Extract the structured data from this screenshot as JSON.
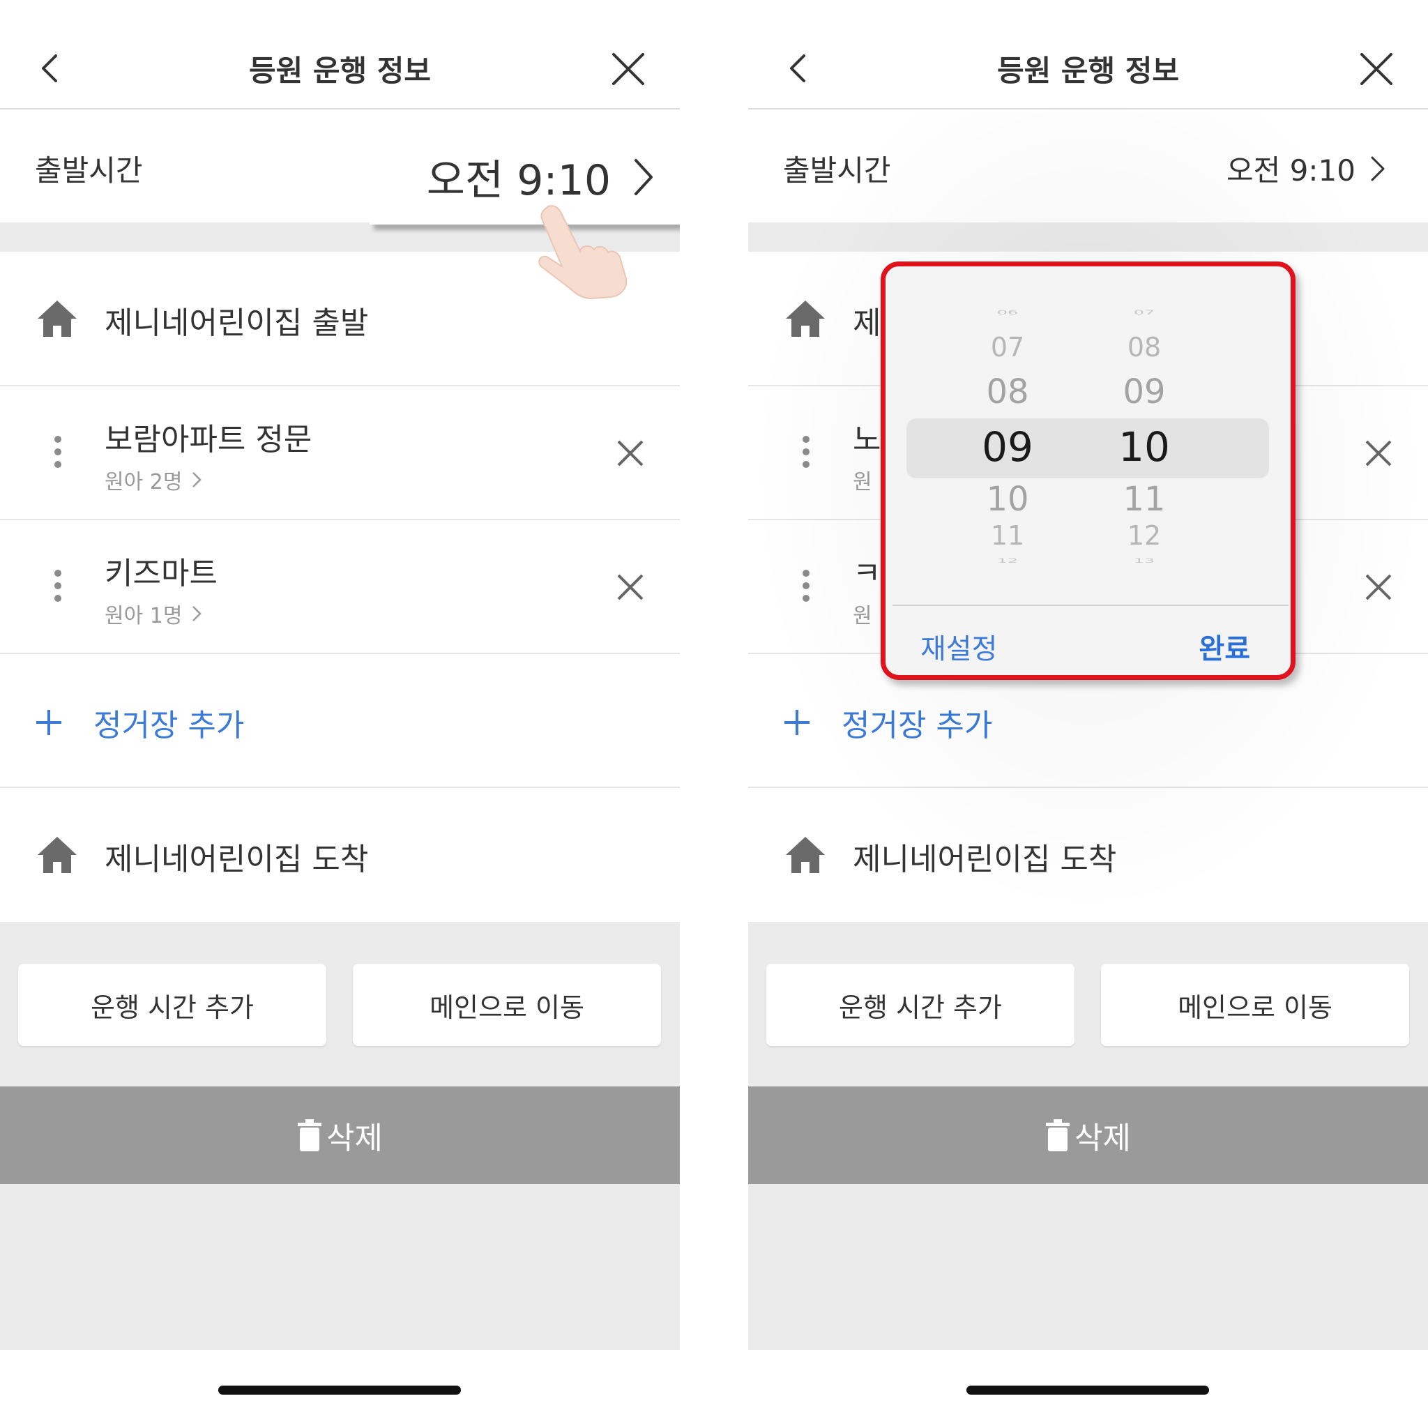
{
  "screens": [
    {
      "header": {
        "title": "등원 운행 정보",
        "back_icon": "chevron-left-icon",
        "close_icon": "close-icon"
      },
      "departure": {
        "label": "출발시간",
        "value": "오전 9:10"
      },
      "zoom_value": "오전 9:10",
      "route": {
        "start_label": "제니네어린이집 출발",
        "stops": [
          {
            "name": "보람아파트 정문",
            "sub": "원아 2명"
          },
          {
            "name": "키즈마트",
            "sub": "원아 1명"
          }
        ],
        "add_label": "정거장 추가",
        "end_label": "제니네어린이집 도착"
      },
      "actions": {
        "add_time": "운행 시간 추가",
        "go_main": "메인으로 이동",
        "delete": "삭제"
      }
    },
    {
      "header": {
        "title": "등원 운행 정보",
        "back_icon": "chevron-left-icon",
        "close_icon": "close-icon"
      },
      "departure": {
        "label": "출발시간",
        "value": "오전 9:10"
      },
      "route": {
        "start_label": "제",
        "stops": [
          {
            "name": "노",
            "sub": "원"
          },
          {
            "name": "ㅋ",
            "sub": "원"
          }
        ],
        "add_label": "정거장 추가",
        "end_label": "제니네어린이집 도착"
      },
      "actions": {
        "add_time": "운행 시간 추가",
        "go_main": "메인으로 이동",
        "delete": "삭제"
      },
      "picker": {
        "hours": [
          "06",
          "07",
          "08",
          "09",
          "10",
          "11",
          "12"
        ],
        "minutes": [
          "07",
          "08",
          "09",
          "10",
          "11",
          "12",
          "13"
        ],
        "selected_hour": "09",
        "selected_minute": "10",
        "reset_label": "재설정",
        "done_label": "완료",
        "highlight_color": "#e0131d"
      }
    }
  ],
  "colors": {
    "accent": "#3b7ad9",
    "delete_bar": "#9a9a9a",
    "background_band": "#ebebeb"
  }
}
